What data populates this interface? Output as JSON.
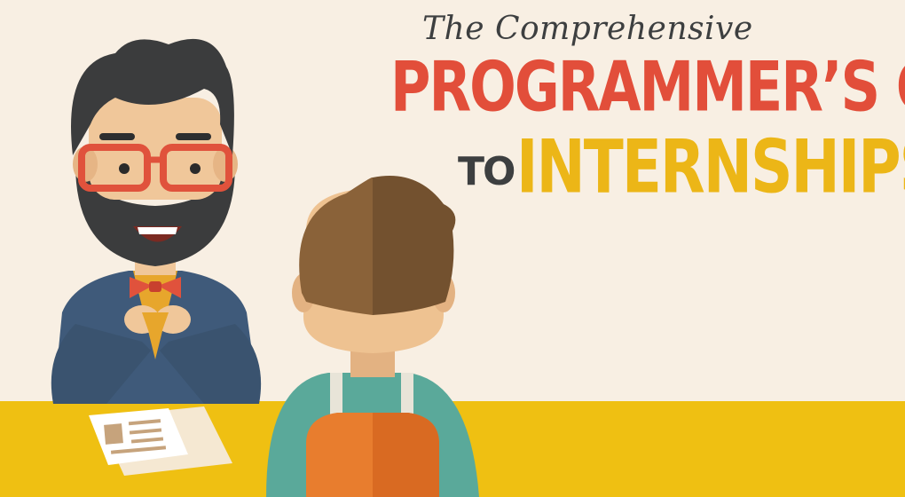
{
  "title": {
    "line1": "The Comprehensive",
    "line2": "PROGRAMMER’S GUIDE",
    "line3_prefix": "TO",
    "line3": "INTERNSHIPS"
  },
  "colors": {
    "background": "#f8efe3",
    "table": "#efc012",
    "title_red": "#e24e3a",
    "title_yellow": "#ecb617",
    "title_dark": "#3d3f40"
  },
  "illustration": {
    "figures": [
      "interviewer-with-beard-and-glasses",
      "candidate-seen-from-behind"
    ]
  }
}
